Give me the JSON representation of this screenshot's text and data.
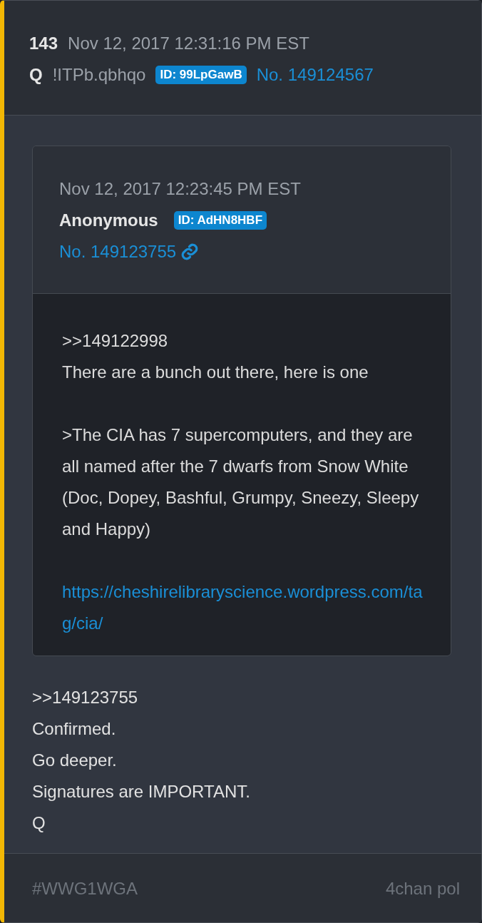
{
  "post": {
    "number": "143",
    "date": "Nov 12, 2017 12:31:16 PM EST",
    "author": "Q",
    "tripcode": "!ITPb.qbhqo",
    "id_badge": "ID: 99LpGawB",
    "post_no": "No. 149124567"
  },
  "quote": {
    "date": "Nov 12, 2017 12:23:45 PM EST",
    "author": "Anonymous",
    "id_badge": "ID: AdHN8HBF",
    "post_no": "No. 149123755",
    "paragraphs": [
      {
        "kind": "text",
        "lines": [
          ">>149122998",
          "There are a bunch out there, here is one"
        ]
      },
      {
        "kind": "text",
        "lines": [
          ">The CIA has 7 supercomputers, and they are all named after the 7 dwarfs from Snow White (Doc, Dopey, Bashful, Grumpy, Sneezy, Sleepy and Happy)"
        ]
      },
      {
        "kind": "link",
        "lines": [
          "https://cheshirelibraryscience.wordpress.com/tag/cia/"
        ]
      }
    ]
  },
  "reply_lines": [
    ">>149123755",
    "Confirmed.",
    "Go deeper.",
    "Signatures are IMPORTANT.",
    "Q"
  ],
  "footer": {
    "tag": "#WWG1WGA",
    "source": "4chan pol"
  }
}
